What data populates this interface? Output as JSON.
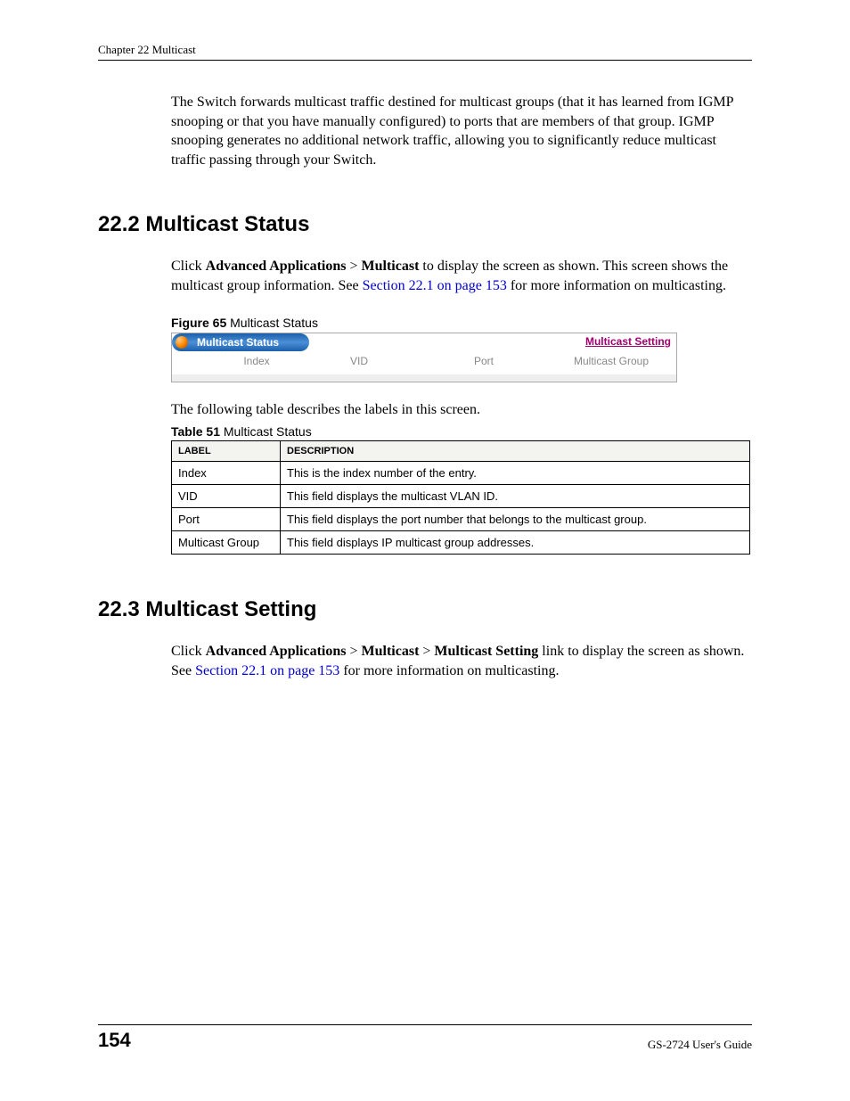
{
  "header": {
    "chapter_line": "Chapter 22 Multicast"
  },
  "intro_paragraph": "The Switch forwards multicast traffic destined for multicast groups (that it has learned from IGMP snooping or that you have manually configured) to ports that are members of that group. IGMP snooping generates no additional network traffic, allowing you to significantly reduce multicast traffic passing through your Switch.",
  "section_22_2": {
    "heading": "22.2  Multicast Status",
    "para_pre": "Click ",
    "bold1": "Advanced Applications",
    "gt1": " > ",
    "bold2": "Multicast",
    "para_mid": " to display the screen as shown. This screen shows the multicast group information. See ",
    "link": "Section 22.1 on page 153",
    "para_post": " for more information on multicasting.",
    "figure_label": "Figure 65",
    "figure_title": "   Multicast Status",
    "screenshot": {
      "tab_title": "Multicast Status",
      "link_text": "Multicast Setting",
      "cols": {
        "index": "Index",
        "vid": "VID",
        "port": "Port",
        "mgroup": "Multicast Group"
      }
    },
    "table_intro": "The following table describes the labels in this screen.",
    "table_label": "Table 51",
    "table_title": "   Multicast Status",
    "table_headers": {
      "label": "LABEL",
      "desc": "DESCRIPTION"
    },
    "rows": [
      {
        "label": "Index",
        "desc": "This is the index number of the entry."
      },
      {
        "label": "VID",
        "desc": "This field displays the multicast VLAN ID."
      },
      {
        "label": "Port",
        "desc": "This field displays the port number that belongs to the multicast group."
      },
      {
        "label": "Multicast Group",
        "desc": "This field displays IP multicast group addresses."
      }
    ]
  },
  "section_22_3": {
    "heading": "22.3  Multicast Setting",
    "para_pre": "Click ",
    "bold1": "Advanced Applications",
    "gt1": " > ",
    "bold2": "Multicast",
    "gt2": " > ",
    "bold3": "Multicast Setting",
    "para_mid": " link to display the screen as shown. See ",
    "link": "Section 22.1 on page 153",
    "para_post": " for more information on multicasting."
  },
  "footer": {
    "page_number": "154",
    "guide": "GS-2724 User's Guide"
  }
}
